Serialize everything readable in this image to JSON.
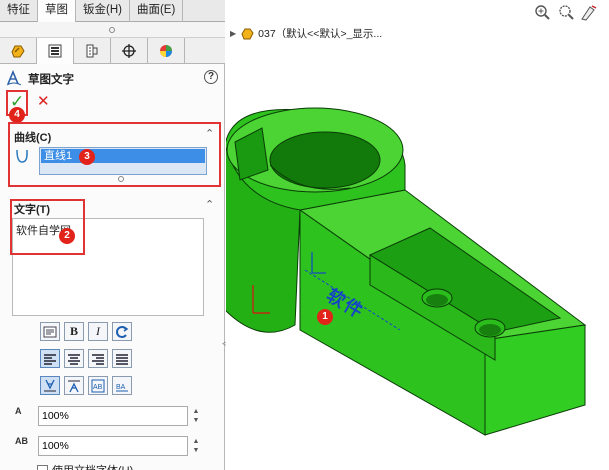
{
  "toolbar_tabs": [
    "特征",
    "草图",
    "钣金(H)",
    "曲面(E)"
  ],
  "active_tab_index": 1,
  "manager_tabs": [
    "propertymanager-icon",
    "featuremanager-icon",
    "configuration-icon",
    "dimxpert-icon",
    "appearance-icon"
  ],
  "property": {
    "title": "草图文字",
    "help": "?",
    "ok": "✓",
    "cancel": "✕"
  },
  "curve": {
    "title": "曲线(C)",
    "item": "直线1"
  },
  "text": {
    "title": "文字(T)",
    "value": "软件自学网"
  },
  "formatting": {
    "row1": [
      "link-icon",
      "B",
      "I",
      "rotate-icon"
    ],
    "row2": [
      "align-left-icon",
      "align-center-icon",
      "align-right-icon",
      "justify-icon"
    ],
    "row3": [
      "flip-vertical-icon",
      "flip-horizontal-icon",
      "text-frame-icon",
      "text-spacing-icon"
    ]
  },
  "width_factor": {
    "label": "A",
    "value": "100%"
  },
  "spacing": {
    "label": "AB",
    "value": "100%"
  },
  "use_doc_font": "使用文档字体(U)",
  "tree_node": "037（默认<<默认>_显示...",
  "model": {
    "engraved_text": "软件",
    "color": "#2ec21f"
  },
  "badges": [
    "1",
    "2",
    "3",
    "4"
  ],
  "colors": {
    "highlight_border": "#e03434",
    "badge": "#e2231a",
    "selection": "#3d8ee6"
  }
}
